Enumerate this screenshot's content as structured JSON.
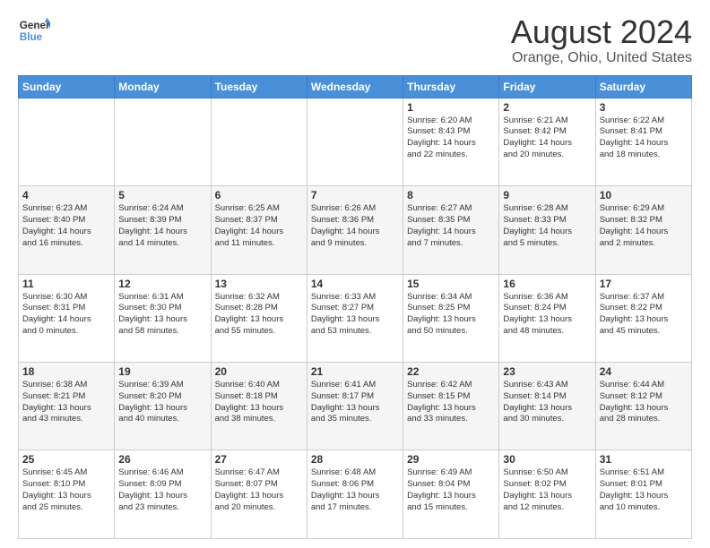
{
  "logo": {
    "text_general": "General",
    "text_blue": "Blue"
  },
  "title": "August 2024",
  "subtitle": "Orange, Ohio, United States",
  "days_of_week": [
    "Sunday",
    "Monday",
    "Tuesday",
    "Wednesday",
    "Thursday",
    "Friday",
    "Saturday"
  ],
  "weeks": [
    [
      {
        "day": "",
        "lines": []
      },
      {
        "day": "",
        "lines": []
      },
      {
        "day": "",
        "lines": []
      },
      {
        "day": "",
        "lines": []
      },
      {
        "day": "1",
        "lines": [
          "Sunrise: 6:20 AM",
          "Sunset: 8:43 PM",
          "Daylight: 14 hours",
          "and 22 minutes."
        ]
      },
      {
        "day": "2",
        "lines": [
          "Sunrise: 6:21 AM",
          "Sunset: 8:42 PM",
          "Daylight: 14 hours",
          "and 20 minutes."
        ]
      },
      {
        "day": "3",
        "lines": [
          "Sunrise: 6:22 AM",
          "Sunset: 8:41 PM",
          "Daylight: 14 hours",
          "and 18 minutes."
        ]
      }
    ],
    [
      {
        "day": "4",
        "lines": [
          "Sunrise: 6:23 AM",
          "Sunset: 8:40 PM",
          "Daylight: 14 hours",
          "and 16 minutes."
        ]
      },
      {
        "day": "5",
        "lines": [
          "Sunrise: 6:24 AM",
          "Sunset: 8:39 PM",
          "Daylight: 14 hours",
          "and 14 minutes."
        ]
      },
      {
        "day": "6",
        "lines": [
          "Sunrise: 6:25 AM",
          "Sunset: 8:37 PM",
          "Daylight: 14 hours",
          "and 11 minutes."
        ]
      },
      {
        "day": "7",
        "lines": [
          "Sunrise: 6:26 AM",
          "Sunset: 8:36 PM",
          "Daylight: 14 hours",
          "and 9 minutes."
        ]
      },
      {
        "day": "8",
        "lines": [
          "Sunrise: 6:27 AM",
          "Sunset: 8:35 PM",
          "Daylight: 14 hours",
          "and 7 minutes."
        ]
      },
      {
        "day": "9",
        "lines": [
          "Sunrise: 6:28 AM",
          "Sunset: 8:33 PM",
          "Daylight: 14 hours",
          "and 5 minutes."
        ]
      },
      {
        "day": "10",
        "lines": [
          "Sunrise: 6:29 AM",
          "Sunset: 8:32 PM",
          "Daylight: 14 hours",
          "and 2 minutes."
        ]
      }
    ],
    [
      {
        "day": "11",
        "lines": [
          "Sunrise: 6:30 AM",
          "Sunset: 8:31 PM",
          "Daylight: 14 hours",
          "and 0 minutes."
        ]
      },
      {
        "day": "12",
        "lines": [
          "Sunrise: 6:31 AM",
          "Sunset: 8:30 PM",
          "Daylight: 13 hours",
          "and 58 minutes."
        ]
      },
      {
        "day": "13",
        "lines": [
          "Sunrise: 6:32 AM",
          "Sunset: 8:28 PM",
          "Daylight: 13 hours",
          "and 55 minutes."
        ]
      },
      {
        "day": "14",
        "lines": [
          "Sunrise: 6:33 AM",
          "Sunset: 8:27 PM",
          "Daylight: 13 hours",
          "and 53 minutes."
        ]
      },
      {
        "day": "15",
        "lines": [
          "Sunrise: 6:34 AM",
          "Sunset: 8:25 PM",
          "Daylight: 13 hours",
          "and 50 minutes."
        ]
      },
      {
        "day": "16",
        "lines": [
          "Sunrise: 6:36 AM",
          "Sunset: 8:24 PM",
          "Daylight: 13 hours",
          "and 48 minutes."
        ]
      },
      {
        "day": "17",
        "lines": [
          "Sunrise: 6:37 AM",
          "Sunset: 8:22 PM",
          "Daylight: 13 hours",
          "and 45 minutes."
        ]
      }
    ],
    [
      {
        "day": "18",
        "lines": [
          "Sunrise: 6:38 AM",
          "Sunset: 8:21 PM",
          "Daylight: 13 hours",
          "and 43 minutes."
        ]
      },
      {
        "day": "19",
        "lines": [
          "Sunrise: 6:39 AM",
          "Sunset: 8:20 PM",
          "Daylight: 13 hours",
          "and 40 minutes."
        ]
      },
      {
        "day": "20",
        "lines": [
          "Sunrise: 6:40 AM",
          "Sunset: 8:18 PM",
          "Daylight: 13 hours",
          "and 38 minutes."
        ]
      },
      {
        "day": "21",
        "lines": [
          "Sunrise: 6:41 AM",
          "Sunset: 8:17 PM",
          "Daylight: 13 hours",
          "and 35 minutes."
        ]
      },
      {
        "day": "22",
        "lines": [
          "Sunrise: 6:42 AM",
          "Sunset: 8:15 PM",
          "Daylight: 13 hours",
          "and 33 minutes."
        ]
      },
      {
        "day": "23",
        "lines": [
          "Sunrise: 6:43 AM",
          "Sunset: 8:14 PM",
          "Daylight: 13 hours",
          "and 30 minutes."
        ]
      },
      {
        "day": "24",
        "lines": [
          "Sunrise: 6:44 AM",
          "Sunset: 8:12 PM",
          "Daylight: 13 hours",
          "and 28 minutes."
        ]
      }
    ],
    [
      {
        "day": "25",
        "lines": [
          "Sunrise: 6:45 AM",
          "Sunset: 8:10 PM",
          "Daylight: 13 hours",
          "and 25 minutes."
        ]
      },
      {
        "day": "26",
        "lines": [
          "Sunrise: 6:46 AM",
          "Sunset: 8:09 PM",
          "Daylight: 13 hours",
          "and 23 minutes."
        ]
      },
      {
        "day": "27",
        "lines": [
          "Sunrise: 6:47 AM",
          "Sunset: 8:07 PM",
          "Daylight: 13 hours",
          "and 20 minutes."
        ]
      },
      {
        "day": "28",
        "lines": [
          "Sunrise: 6:48 AM",
          "Sunset: 8:06 PM",
          "Daylight: 13 hours",
          "and 17 minutes."
        ]
      },
      {
        "day": "29",
        "lines": [
          "Sunrise: 6:49 AM",
          "Sunset: 8:04 PM",
          "Daylight: 13 hours",
          "and 15 minutes."
        ]
      },
      {
        "day": "30",
        "lines": [
          "Sunrise: 6:50 AM",
          "Sunset: 8:02 PM",
          "Daylight: 13 hours",
          "and 12 minutes."
        ]
      },
      {
        "day": "31",
        "lines": [
          "Sunrise: 6:51 AM",
          "Sunset: 8:01 PM",
          "Daylight: 13 hours",
          "and 10 minutes."
        ]
      }
    ]
  ]
}
